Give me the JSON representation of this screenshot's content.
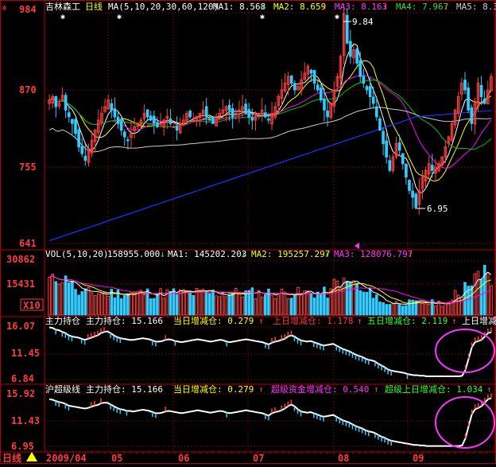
{
  "colors": {
    "bg": "#000000",
    "axis": "#b40000",
    "up": "#ff4040",
    "down": "#33ccff",
    "white": "#ffffff",
    "ma1": "#ffffff",
    "ma2": "#ffff00",
    "ma3": "#ff00ff",
    "ma4": "#00c800",
    "ma5": "#cccccc",
    "ma6": "#2233ff",
    "circle": "#ff33ff"
  },
  "header": {
    "settings_icon": "gear-icon",
    "stock_name": "吉林森工",
    "period": "日线",
    "ma_params": "MA(5,10,20,30,60,120)",
    "ma1": "MA1: 8.568",
    "ma2": "MA2: 8.659",
    "ma3": "MA3: 8.163",
    "ma4": "MA4: 7.967",
    "ma5": "MA5: 8.3",
    "peak_label": "9.84",
    "low_label": "6.95"
  },
  "vol_header": {
    "title": "VOL(5,10,20)",
    "vol": "158955.000",
    "ma1": "MA1: 145202.203",
    "ma2": "MA2: 195257.297",
    "ma3": "MA3: 128076.797"
  },
  "ind1_header": {
    "name": "主力持仓",
    "main": "主力持仓: 15.166",
    "day": "当日增减仓: 0.279",
    "up_day": "上日增减仓: 1.178",
    "five_day": "五日增减仓: 2.119",
    "last_day": "上日增减"
  },
  "ind2_header": {
    "name": "沪超级线",
    "main": "主力持仓: 15.166",
    "day": "当日增减仓: 0.279",
    "super": "超级资金增减仓: 0.540",
    "super_up": "超级上日增减仓: 1.034"
  },
  "axis": {
    "price_ticks": [
      "984",
      "870",
      "755",
      "641"
    ],
    "vol_ticks": [
      "30862",
      "15431"
    ],
    "vol_unit": "X10",
    "ind1_ticks": [
      "16.07",
      "11.45",
      "6.84"
    ],
    "ind2_ticks": [
      "15.92",
      "11.43",
      "6.95"
    ]
  },
  "footer": {
    "period_label": "日线",
    "months": [
      "2009/04",
      "05",
      "06",
      "07",
      "08",
      "09"
    ]
  },
  "chart_data": [
    {
      "type": "candlestick",
      "panel": "price",
      "ylim": [
        6.41,
        9.84
      ],
      "y_ticks": [
        9.84,
        8.7,
        7.55,
        6.41
      ],
      "annotations": [
        {
          "label": "9.84",
          "value": 9.84
        },
        {
          "label": "6.95",
          "value": 6.95
        }
      ],
      "series": [
        {
          "name": "MA1",
          "value": 8.568
        },
        {
          "name": "MA2",
          "value": 8.659
        },
        {
          "name": "MA3",
          "value": 8.163
        },
        {
          "name": "MA4",
          "value": 7.967
        },
        {
          "name": "MA5",
          "value": 8.3
        }
      ],
      "closes": [
        8.55,
        8.6,
        8.45,
        8.5,
        8.62,
        8.4,
        8.3,
        8.2,
        8.05,
        7.85,
        7.75,
        7.65,
        7.8,
        7.95,
        8.1,
        8.25,
        8.35,
        8.45,
        8.55,
        8.4,
        8.3,
        8.2,
        8.1,
        8.0,
        7.95,
        8.05,
        8.15,
        8.2,
        8.25,
        8.35,
        8.3,
        8.25,
        8.2,
        8.15,
        8.2,
        8.25,
        8.3,
        8.2,
        8.15,
        8.1,
        8.2,
        8.25,
        8.35,
        8.3,
        8.25,
        8.3,
        8.35,
        8.4,
        8.3,
        8.25,
        8.2,
        8.3,
        8.35,
        8.4,
        8.45,
        8.4,
        8.3,
        8.35,
        8.4,
        8.45,
        8.35,
        8.3,
        8.25,
        8.3,
        8.35,
        8.4,
        8.3,
        8.25,
        8.35,
        8.45,
        8.6,
        8.7,
        8.8,
        8.9,
        8.8,
        8.7,
        8.75,
        8.85,
        8.95,
        9.05,
        8.95,
        8.8,
        8.7,
        8.55,
        8.4,
        8.3,
        8.5,
        8.7,
        8.9,
        9.2,
        9.84,
        9.4,
        9.2,
        9.3,
        9.1,
        8.9,
        8.8,
        8.7,
        8.6,
        8.5,
        8.3,
        8.1,
        7.9,
        7.7,
        7.5,
        7.7,
        7.9,
        7.8,
        7.6,
        7.4,
        7.2,
        7.1,
        6.95,
        7.2,
        7.4,
        7.5,
        7.6,
        7.5,
        7.55,
        7.6,
        7.7,
        7.85,
        8.0,
        8.2,
        8.4,
        8.6,
        8.8,
        8.7,
        8.4,
        8.2,
        8.5,
        8.8,
        8.6,
        8.5,
        8.7,
        8.9
      ]
    },
    {
      "type": "bar",
      "panel": "volume",
      "ylim": [
        0,
        30862
      ],
      "y_ticks": [
        30862,
        15431
      ],
      "series": [
        {
          "name": "VOL",
          "value": 158955.0
        },
        {
          "name": "MA1",
          "value": 145202.203
        },
        {
          "name": "MA2",
          "value": 195257.297
        },
        {
          "name": "MA3",
          "value": 128076.797
        }
      ]
    },
    {
      "type": "line",
      "panel": "主力持仓",
      "ylim": [
        6.84,
        16.07
      ],
      "y_ticks": [
        16.07,
        11.45,
        6.84
      ],
      "values": [
        16.0,
        15.9,
        15.6,
        15.5,
        15.2,
        15.0,
        14.6,
        14.4,
        14.3,
        14.2,
        14.0,
        13.8,
        14.0,
        14.2,
        14.4,
        14.6,
        15.0,
        15.2,
        15.3,
        15.0,
        14.6,
        14.3,
        14.1,
        14.0,
        13.9,
        13.8,
        13.8,
        13.9,
        14.0,
        14.1,
        14.0,
        13.9,
        13.7,
        13.5,
        13.5,
        13.6,
        13.8,
        13.9,
        13.8,
        13.6,
        13.5,
        13.4,
        13.5,
        13.6,
        13.7,
        13.8,
        13.9,
        13.8,
        13.7,
        13.6,
        13.5,
        13.6,
        13.7,
        13.8,
        13.7,
        13.5,
        13.4,
        13.5,
        13.6,
        13.7,
        13.8,
        13.9,
        13.8,
        13.7,
        13.6,
        13.5,
        13.4,
        13.2,
        13.0,
        13.3,
        13.5,
        13.6,
        13.8,
        14.0,
        14.4,
        14.6,
        14.4,
        14.0,
        13.7,
        13.6,
        13.5,
        13.6,
        13.4,
        13.2,
        13.0,
        12.8,
        12.9,
        13.0,
        13.1,
        12.8,
        12.5,
        12.2,
        12.0,
        11.8,
        11.5,
        11.2,
        11.0,
        10.8,
        10.5,
        10.3,
        10.2,
        10.0,
        9.6,
        9.3,
        9.0,
        8.6,
        8.4,
        8.3,
        8.2,
        8.1,
        8.0,
        7.8,
        7.7,
        7.6,
        7.6,
        7.5,
        7.5,
        7.4,
        7.4,
        7.4,
        7.4,
        7.4,
        7.4,
        7.4,
        7.4,
        7.4,
        7.4,
        7.4,
        7.5,
        8.5,
        10.5,
        12.5,
        13.4,
        13.6,
        13.8,
        14.4,
        15.0,
        15.166
      ]
    },
    {
      "type": "line",
      "panel": "沪超级线",
      "ylim": [
        6.95,
        15.92
      ],
      "y_ticks": [
        15.92,
        11.43,
        6.95
      ],
      "values": [
        15.0,
        14.9,
        14.7,
        14.5,
        14.4,
        14.2,
        13.9,
        13.8,
        13.7,
        13.6,
        13.5,
        13.4,
        13.5,
        13.7,
        13.9,
        14.0,
        14.3,
        14.4,
        14.4,
        14.1,
        13.8,
        13.5,
        13.3,
        13.2,
        13.0,
        13.0,
        12.9,
        13.0,
        13.1,
        13.2,
        13.1,
        13.0,
        12.8,
        12.6,
        12.6,
        12.7,
        12.9,
        13.0,
        12.9,
        12.8,
        12.7,
        12.6,
        12.7,
        12.8,
        12.9,
        13.0,
        13.1,
        13.0,
        12.9,
        12.8,
        12.7,
        12.8,
        12.9,
        13.0,
        12.9,
        12.7,
        12.6,
        12.7,
        12.8,
        12.9,
        13.0,
        13.1,
        13.0,
        12.9,
        12.8,
        12.7,
        12.6,
        12.4,
        12.2,
        12.6,
        12.8,
        12.9,
        13.1,
        13.4,
        13.8,
        14.1,
        13.8,
        13.3,
        12.9,
        12.8,
        12.7,
        12.8,
        12.6,
        12.4,
        12.2,
        12.0,
        12.1,
        12.2,
        12.3,
        12.0,
        11.7,
        11.4,
        11.2,
        11.0,
        10.7,
        10.4,
        10.2,
        10.0,
        9.7,
        9.5,
        9.4,
        9.2,
        8.9,
        8.6,
        8.4,
        8.1,
        7.9,
        7.8,
        7.7,
        7.6,
        7.5,
        7.4,
        7.3,
        7.2,
        7.2,
        7.1,
        7.1,
        7.0,
        7.0,
        7.0,
        7.0,
        7.0,
        7.0,
        7.0,
        7.0,
        7.0,
        7.0,
        7.0,
        7.1,
        8.3,
        10.4,
        12.4,
        13.3,
        13.5,
        13.8,
        14.4,
        15.0,
        15.166
      ]
    }
  ]
}
